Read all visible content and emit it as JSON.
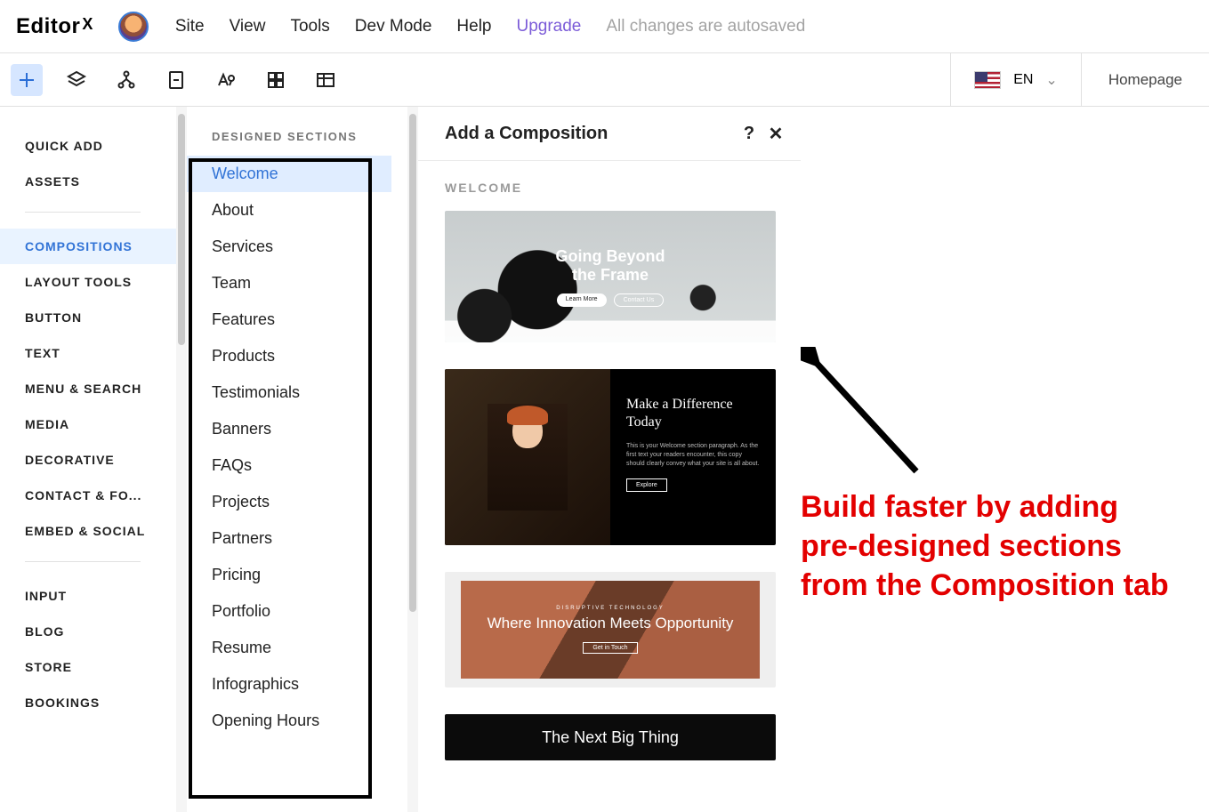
{
  "brand": {
    "name": "Editor",
    "suffix": "X"
  },
  "top_menu": {
    "items": [
      "Site",
      "View",
      "Tools",
      "Dev Mode",
      "Help"
    ],
    "upgrade": "Upgrade",
    "autosave": "All changes are autosaved"
  },
  "toolbar2": {
    "language_code": "EN",
    "page_label": "Homepage"
  },
  "toolbar_icons": [
    "add-icon",
    "layers-icon",
    "tree-icon",
    "page-icon",
    "text-style-icon",
    "grid-icon",
    "data-icon"
  ],
  "left_categories": {
    "group1": [
      "QUICK ADD",
      "ASSETS"
    ],
    "group2": [
      "COMPOSITIONS",
      "LAYOUT TOOLS",
      "BUTTON",
      "TEXT",
      "MENU & SEARCH",
      "MEDIA",
      "DECORATIVE",
      "CONTACT & FO...",
      "EMBED & SOCIAL"
    ],
    "group3": [
      "INPUT",
      "BLOG",
      "STORE",
      "BOOKINGS"
    ],
    "selected": "COMPOSITIONS"
  },
  "sections_header": "DESIGNED SECTIONS",
  "designed_sections": [
    "Welcome",
    "About",
    "Services",
    "Team",
    "Features",
    "Products",
    "Testimonials",
    "Banners",
    "FAQs",
    "Projects",
    "Partners",
    "Pricing",
    "Portfolio",
    "Resume",
    "Infographics",
    "Opening Hours"
  ],
  "designed_selected": "Welcome",
  "panel": {
    "title": "Add a Composition",
    "section_label": "WELCOME",
    "help_glyph": "?",
    "close_glyph": "✕"
  },
  "previews": {
    "card1": {
      "line1": "Going Beyond",
      "line2": "the Frame",
      "btn1": "Learn More",
      "btn2": "Contact Us"
    },
    "card2": {
      "heading": "Make a Difference Today",
      "para": "This is your Welcome section paragraph. As the first text your readers encounter, this copy should clearly convey what your site is all about.",
      "btn": "Explore"
    },
    "card3": {
      "eyebrow": "DISRUPTIVE TECHNOLOGY",
      "heading": "Where Innovation Meets Opportunity",
      "btn": "Get in Touch"
    },
    "card4": {
      "heading": "The Next Big Thing"
    }
  },
  "annotation": "Build faster by adding pre-designed sections from the Composition tab"
}
